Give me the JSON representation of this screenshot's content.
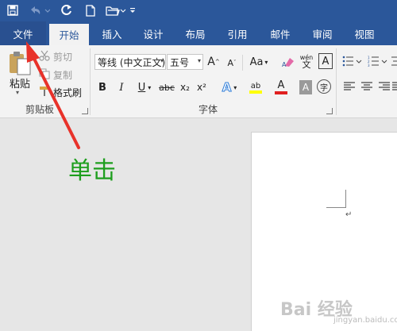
{
  "quick_access": {
    "icons": [
      "save-icon",
      "undo-icon",
      "redo-icon",
      "new-document-icon",
      "open-folder-icon",
      "customize-icon"
    ]
  },
  "tabs": [
    {
      "label": "文件"
    },
    {
      "label": "开始"
    },
    {
      "label": "插入"
    },
    {
      "label": "设计"
    },
    {
      "label": "布局"
    },
    {
      "label": "引用"
    },
    {
      "label": "邮件"
    },
    {
      "label": "审阅"
    },
    {
      "label": "视图"
    }
  ],
  "clipboard": {
    "paste_label": "粘贴",
    "cut_label": "剪切",
    "copy_label": "复制",
    "format_painter_label": "格式刷",
    "group_label": "剪贴板"
  },
  "font": {
    "font_name": "等线 (中文正文)",
    "font_size": "五号",
    "grow_label": "A",
    "shrink_label": "A",
    "case_label": "Aa",
    "phonetic_label": "wén",
    "charborder_label": "A",
    "bold_label": "B",
    "italic_label": "I",
    "underline_label": "U",
    "strike_label": "abc",
    "subscript_label": "x₂",
    "superscript_label": "x²",
    "effects_label": "A",
    "highlight_label": "ab",
    "fontcolor_label": "A",
    "shading_label": "A",
    "enclose_label": "字",
    "group_label": "字体"
  },
  "annotation": {
    "text": "单击",
    "color": "#1e9e1e"
  },
  "document": {
    "paragraph_mark": "↵"
  },
  "watermark": {
    "text": "Bai 经验",
    "sub": "jingyan.baidu.com"
  },
  "colors": {
    "brand": "#2b579a",
    "arrow": "#e8322a",
    "highlight": "#ffff00",
    "font_color": "#e02020"
  }
}
